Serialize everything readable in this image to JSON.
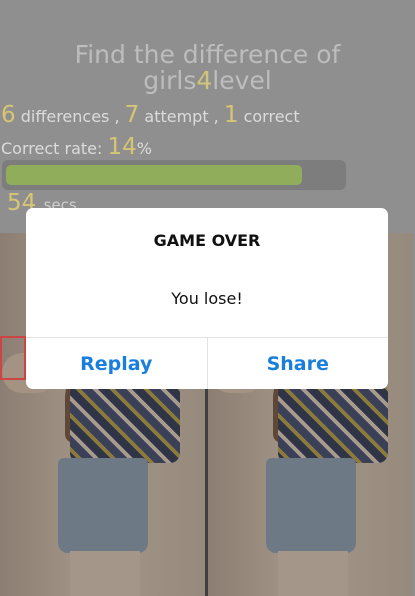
{
  "header": {
    "title_line1": "Find the difference of",
    "title_prefix": "girls",
    "title_level": "4",
    "title_suffix": "level"
  },
  "stats": {
    "differences_count": "6",
    "differences_label": " differences ,",
    "attempt_count": "7",
    "attempt_label": " attempt ,",
    "correct_count": "1",
    "correct_label": " correct"
  },
  "rate": {
    "label": "Correct rate: ",
    "value": "14",
    "unit": "%"
  },
  "progress": {
    "fraction": 0.88,
    "fill_color": "#90ad5b"
  },
  "timer": {
    "value": "54",
    "unit": "secs"
  },
  "dialog": {
    "title": "GAME OVER",
    "message": "You lose!",
    "buttons": {
      "replay": "Replay",
      "share": "Share"
    },
    "button_color": "#1a7fdc"
  },
  "images": {
    "left": {
      "icon": "photo-girl-left"
    },
    "right": {
      "icon": "photo-girl-right"
    },
    "marker_color": "#cc4444"
  }
}
